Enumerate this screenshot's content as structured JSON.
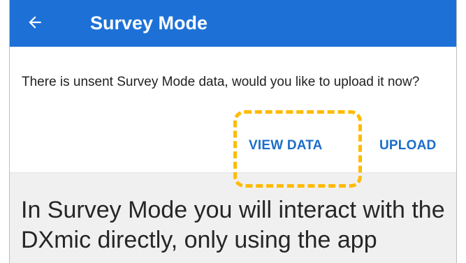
{
  "app_bar": {
    "title": "Survey Mode",
    "background_color": "#1d71d6",
    "back_icon": "arrow-left-icon"
  },
  "dialog": {
    "message": "There is unsent Survey Mode data, would you like to upload it now?",
    "buttons": {
      "view_data_label": "VIEW DATA",
      "upload_label": "UPLOAD"
    },
    "button_color": "#1c6dc9",
    "highlight_color": "#ffbb00"
  },
  "content": {
    "intro_text": "In Survey Mode you will interact with the DXmic directly, only using the app"
  }
}
